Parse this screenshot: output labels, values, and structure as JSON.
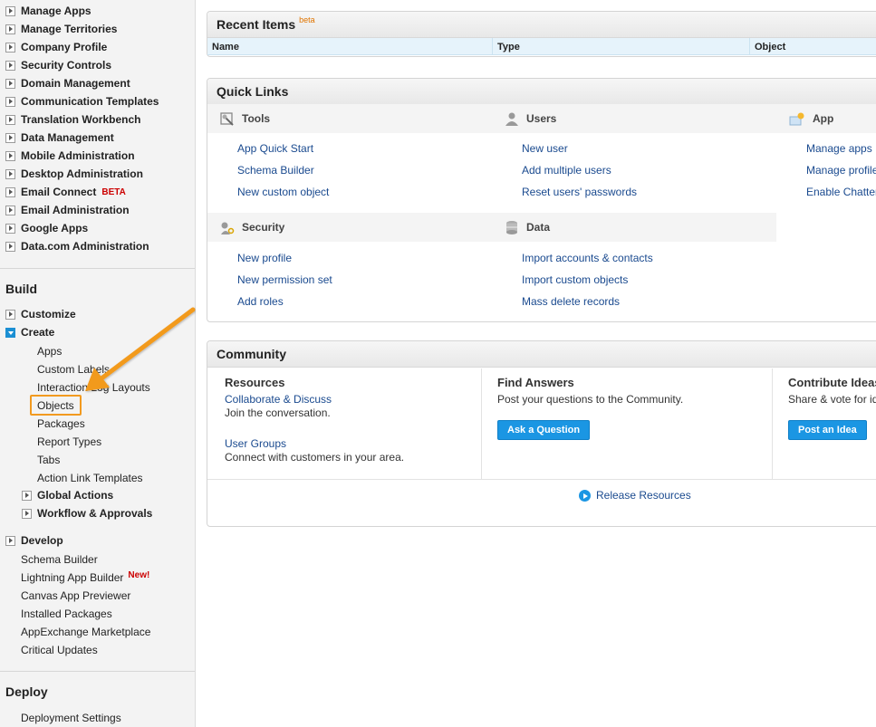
{
  "sidebar": {
    "admin_items": [
      {
        "label": "Manage Apps"
      },
      {
        "label": "Manage Territories"
      },
      {
        "label": "Company Profile"
      },
      {
        "label": "Security Controls"
      },
      {
        "label": "Domain Management"
      },
      {
        "label": "Communication Templates"
      },
      {
        "label": "Translation Workbench"
      },
      {
        "label": "Data Management"
      },
      {
        "label": "Mobile Administration"
      },
      {
        "label": "Desktop Administration"
      },
      {
        "label": "Email Connect",
        "badge": "BETA"
      },
      {
        "label": "Email Administration"
      },
      {
        "label": "Google Apps"
      },
      {
        "label": "Data.com Administration"
      }
    ],
    "build": {
      "title": "Build",
      "customize": "Customize",
      "create": "Create",
      "create_children": [
        "Apps",
        "Custom Labels",
        "Interaction Log Layouts",
        "Objects",
        "Packages",
        "Report Types",
        "Tabs",
        "Action Link Templates"
      ],
      "global_actions": "Global Actions",
      "workflow": "Workflow & Approvals",
      "develop": "Develop",
      "plain_items": [
        {
          "label": "Schema Builder"
        },
        {
          "label": "Lightning App Builder",
          "badge": "New!"
        },
        {
          "label": "Canvas App Previewer"
        },
        {
          "label": "Installed Packages"
        },
        {
          "label": "AppExchange Marketplace"
        },
        {
          "label": "Critical Updates"
        }
      ]
    },
    "deploy": {
      "title": "Deploy",
      "items": [
        "Deployment Settings"
      ]
    }
  },
  "recent_items": {
    "title": "Recent Items",
    "badge": "beta",
    "columns": [
      "Name",
      "Type",
      "Object"
    ]
  },
  "quick_links": {
    "title": "Quick Links",
    "tools": {
      "title": "Tools",
      "icon": "tools-icon",
      "links": [
        "App Quick Start",
        "Schema Builder",
        "New custom object"
      ]
    },
    "users": {
      "title": "Users",
      "icon": "user-icon",
      "links": [
        "New user",
        "Add multiple users",
        "Reset users' passwords"
      ]
    },
    "app": {
      "title": "App",
      "icon": "app-icon",
      "links": [
        "Manage apps",
        "Manage profile",
        "Enable Chatter"
      ]
    },
    "security": {
      "title": "Security",
      "icon": "key-icon",
      "links": [
        "New profile",
        "New permission set",
        "Add roles"
      ]
    },
    "data": {
      "title": "Data",
      "icon": "database-icon",
      "links": [
        "Import accounts & contacts",
        "Import custom objects",
        "Mass delete records"
      ]
    }
  },
  "community": {
    "title": "Community",
    "resources": {
      "title": "Resources",
      "link1": "Collaborate & Discuss",
      "text1": "Join the conversation.",
      "link2": "User Groups",
      "text2": "Connect with customers in your area."
    },
    "find_answers": {
      "title": "Find Answers",
      "text": "Post your questions to the Community.",
      "button": "Ask a Question"
    },
    "contribute": {
      "title": "Contribute Ideas",
      "text": "Share & vote for ideas",
      "button": "Post an Idea"
    },
    "release": "Release Resources"
  },
  "colors": {
    "accent_blue": "#1b96e3",
    "link": "#1a4a8f",
    "highlight_orange": "#f29a1f",
    "badge_red": "#cc0000"
  }
}
